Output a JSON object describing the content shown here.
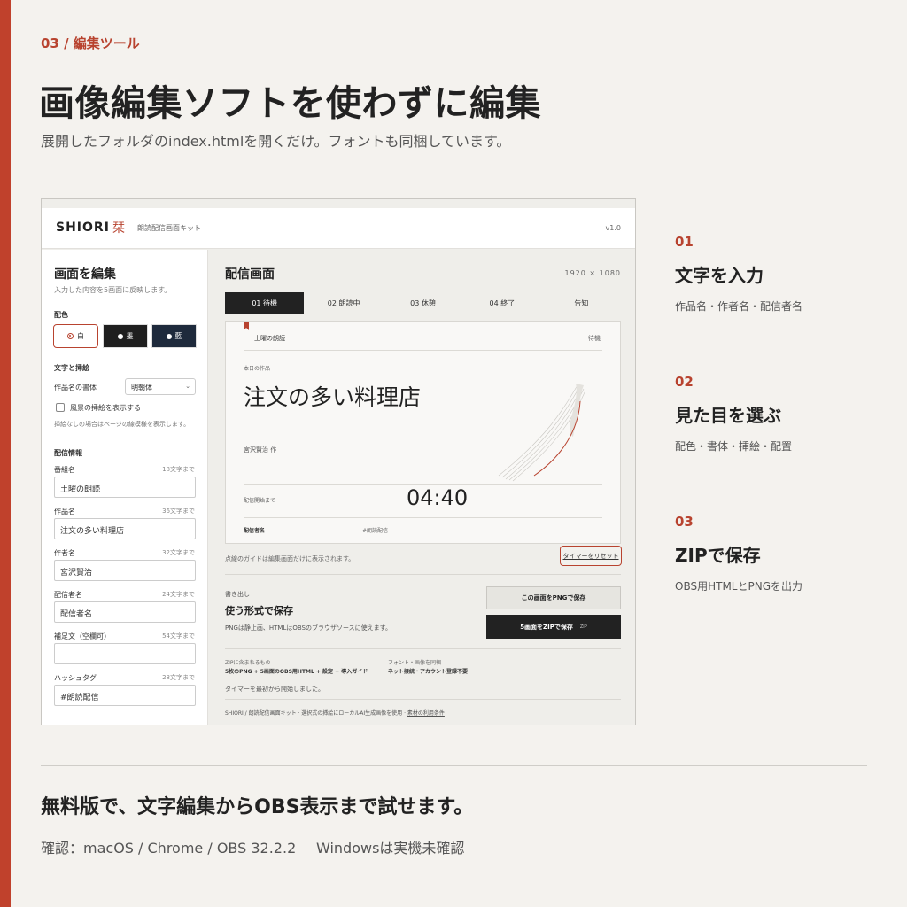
{
  "section": {
    "eyebrow": "03 / 編集ツール"
  },
  "hero": {
    "title": "画像編集ソフトを使わずに編集",
    "subtitle": "展開したフォルダのindex.htmlを開くだけ。フォントも同梱しています。"
  },
  "app": {
    "brand": "SHIORI",
    "brand_mark": "栞",
    "brand_sub": "朗読配信画面キット",
    "version": "v1.0",
    "sidebar": {
      "title": "画面を編集",
      "desc": "入力した内容を5画面に反映します。",
      "color_label": "配色",
      "swatches": [
        "白",
        "墨",
        "藍"
      ],
      "text_label": "文字と挿絵",
      "font_row_label": "作品名の書体",
      "font_value": "明朝体",
      "checkbox_label": "風景の挿絵を表示する",
      "checkbox_note": "挿絵なしの場合はページの線模様を表示します。",
      "info_label": "配信情報",
      "fields": [
        {
          "label": "番組名",
          "limit": "18文字まで",
          "value": "土曜の朗読"
        },
        {
          "label": "作品名",
          "limit": "36文字まで",
          "value": "注文の多い料理店"
        },
        {
          "label": "作者名",
          "limit": "32文字まで",
          "value": "宮沢賢治"
        },
        {
          "label": "配信者名",
          "limit": "24文字まで",
          "value": "配信者名"
        },
        {
          "label": "補足文（空欄可）",
          "limit": "54文字まで",
          "value": ""
        },
        {
          "label": "ハッシュタグ",
          "limit": "28文字まで",
          "value": "#朗読配信"
        }
      ]
    },
    "main": {
      "title": "配信画面",
      "resolution": "1920 × 1080",
      "tabs": [
        "01 待機",
        "02 朗読中",
        "03 休憩",
        "04 終了",
        "告知"
      ],
      "preview": {
        "show": "土曜の朗読",
        "state": "待機",
        "caption": "本日の作品",
        "work": "注文の多い料理店",
        "author": "宮沢賢治 作",
        "countdown_label": "配信開始まで",
        "timer": "04:40",
        "broadcaster_label": "配信者名",
        "hashtag": "#朗読配信"
      },
      "guide_note": "点線のガイドは編集画面だけに表示されます。",
      "reset_label": "タイマーをリセット",
      "export": {
        "kicker": "書き出し",
        "title": "使う形式で保存",
        "desc": "PNGは静止画、HTMLはOBSのブラウザソースに使えます。",
        "png_button": "この画面をPNGで保存",
        "zip_button": "5画面をZIPで保存",
        "zip_tag": "ZIP"
      },
      "zip_includes_label": "ZIPに含まれるもの",
      "zip_includes_value": "5枚のPNG + 5画面のOBS用HTML + 設定 + 導入ガイド",
      "font_includes_label": "フォント・画像を同梱",
      "font_includes_value": "ネット接続・アカウント登録不要",
      "timer_message": "タイマーを最初から開始しました。",
      "footer_text": "SHIORI / 朗読配信画面キット · 選択式の挿絵にローカルAI生成画像を使用 · ",
      "footer_link": "素材の利用条件"
    }
  },
  "steps": [
    {
      "num": "01",
      "title": "文字を入力",
      "desc": "作品名・作者名・配信者名"
    },
    {
      "num": "02",
      "title": "見た目を選ぶ",
      "desc": "配色・書体・挿絵・配置"
    },
    {
      "num": "03",
      "title": "ZIPで保存",
      "desc": "OBS用HTMLとPNGを出力"
    }
  ],
  "bottom": {
    "message": "無料版で、文字編集からOBS表示まで試せます。",
    "confirm": "確認：macOS / Chrome / OBS 32.2.2",
    "windows": "Windowsは実機未確認"
  },
  "colors": {
    "accent": "#c0412c",
    "background": "#f4f2ee",
    "dark": "#222222",
    "indigo": "#1e2a3c"
  }
}
